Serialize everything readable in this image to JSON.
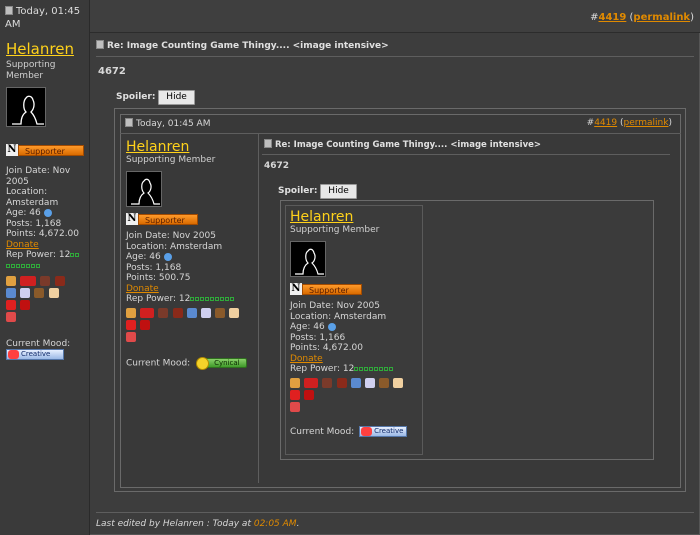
{
  "post": {
    "date": "Today, 01:45 AM",
    "hash": "#",
    "number": "4419",
    "permalink": "permalink",
    "title": "Re: Image Counting Game Thingy.... <image intensive>",
    "body": "4672",
    "spoiler_label": "Spoiler:",
    "hide_button": "Hide",
    "last_edited_prefix": "Last edited by Helanren : Today at",
    "last_edited_time": "02:05 AM",
    "last_edited_suffix": "."
  },
  "user": {
    "name": "Helanren",
    "title": "Supporting Member",
    "badge_letter": "N",
    "badge_text": "Supporter",
    "join_date": "Join Date: Nov 2005",
    "location": "Location: Amsterdam",
    "age": "Age: 46",
    "posts": "Posts: 1,168",
    "points": "Points: 4,672.00",
    "donate": "Donate",
    "rep_power": "Rep Power: 12",
    "current_mood": "Current Mood:",
    "mood": "Creative"
  },
  "inner": {
    "date": "Today, 01:45 AM",
    "number": "4419",
    "permalink": "permalink",
    "title": "Re: Image Counting Game Thingy.... <image intensive>",
    "body": "4672",
    "spoiler_label": "Spoiler:",
    "hide_button": "Hide",
    "user": {
      "name": "Helanren",
      "title": "Supporting Member",
      "join_date": "Join Date: Nov 2005",
      "location": "Location: Amsterdam",
      "age": "Age: 46",
      "posts": "Posts: 1,168",
      "points": "Points: 500.75",
      "donate": "Donate",
      "rep_power": "Rep Power: 12",
      "current_mood": "Current Mood:",
      "mood": "Cynical"
    }
  },
  "innermost": {
    "user": {
      "name": "Helanren",
      "title": "Supporting Member",
      "join_date": "Join Date: Nov 2005",
      "location": "Location: Amsterdam",
      "age": "Age: 46",
      "posts": "Posts: 1,166",
      "points": "Points: 4,672.00",
      "donate": "Donate",
      "rep_power": "Rep Power: 12",
      "current_mood": "Current Mood:",
      "mood": "Creative"
    }
  }
}
